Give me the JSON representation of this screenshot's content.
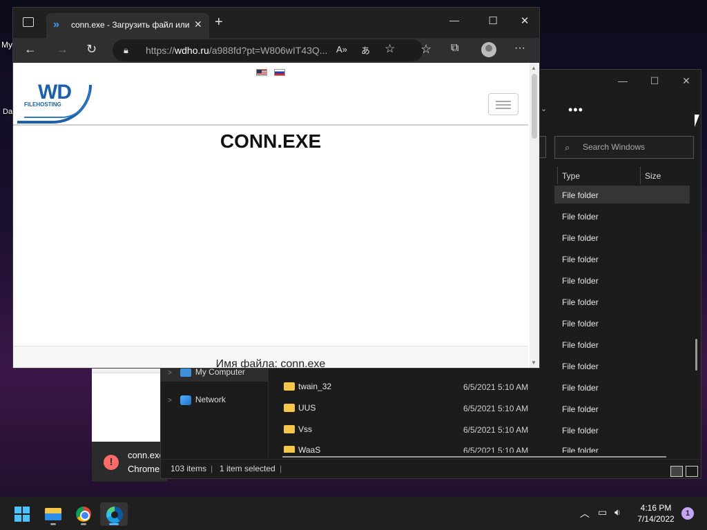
{
  "desktop": {
    "icon_text_1": "My",
    "icon_text_2": "Da"
  },
  "chrome_notification": {
    "line1": "conn.exe",
    "line2": "Chrome",
    "error_glyph": "!"
  },
  "explorer": {
    "more_glyph": "•••",
    "search_placeholder": "Search Windows",
    "columns": {
      "type": "Type",
      "size": "Size"
    },
    "type_values": [
      "File folder",
      "File folder",
      "File folder",
      "File folder",
      "File folder",
      "File folder",
      "File folder",
      "File folder",
      "File folder",
      "File folder",
      "File folder",
      "File folder",
      "File folder"
    ],
    "nav": {
      "my_computer": "My Computer",
      "network": "Network"
    },
    "files": [
      {
        "name": "twain_32",
        "date": "6/5/2021 5:10 AM"
      },
      {
        "name": "UUS",
        "date": "6/5/2021 5:10 AM"
      },
      {
        "name": "Vss",
        "date": "6/5/2021 5:10 AM"
      },
      {
        "name": "WaaS",
        "date": "6/5/2021 5:10 AM"
      }
    ],
    "status": {
      "items": "103 items",
      "selected": "1 item selected"
    },
    "controls": {
      "minimize": "—",
      "maximize": "☐",
      "close": "✕"
    }
  },
  "browser": {
    "tab_title": "conn.exe - Загрузить файл или с",
    "tab_close": "✕",
    "new_tab": "+",
    "url_host": "wdho.ru",
    "url_prefix": "https://",
    "url_rest": "/a988fd?pt=W806wIT43Q...",
    "controls": {
      "minimize": "—",
      "maximize": "☐",
      "close": "✕"
    },
    "page": {
      "logo_text": "WD",
      "logo_sub": "FILEHOSTING",
      "title": "CONN.EXE",
      "file_name_label": "Имя файла: conn.exe"
    }
  },
  "taskbar": {
    "time": "4:16 PM",
    "date": "7/14/2022",
    "notification_count": "1"
  }
}
